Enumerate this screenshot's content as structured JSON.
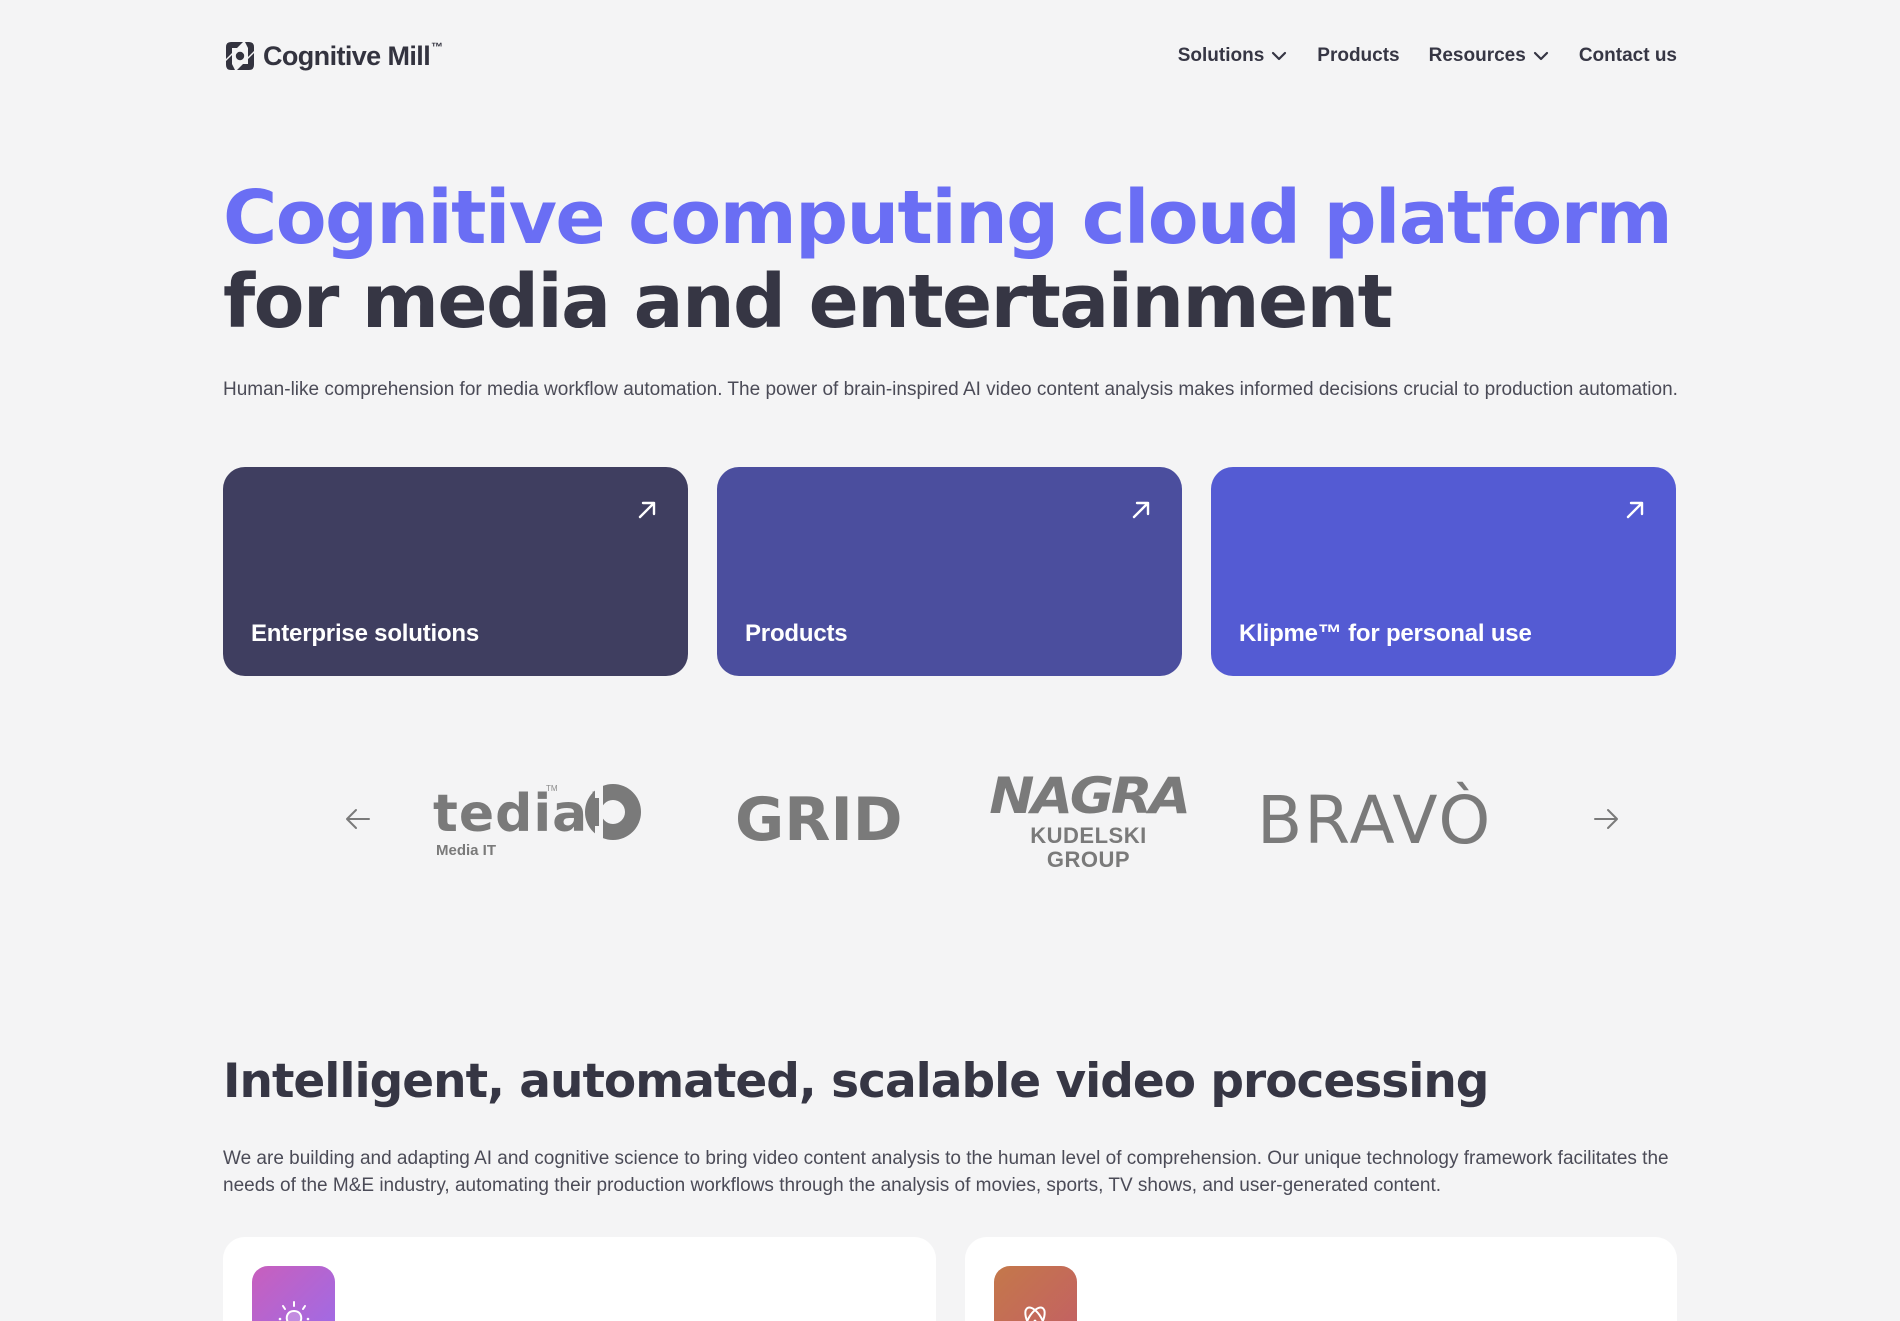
{
  "header": {
    "logo_text": "Cognitive Mill",
    "logo_tm": "™",
    "nav": [
      {
        "label": "Solutions",
        "has_dropdown": true
      },
      {
        "label": "Products",
        "has_dropdown": false
      },
      {
        "label": "Resources",
        "has_dropdown": true
      },
      {
        "label": "Contact us",
        "has_dropdown": false
      }
    ]
  },
  "hero": {
    "title_line1": "Cognitive computing cloud platform",
    "title_line2": "for media and entertainment",
    "subtitle": "Human-like comprehension for media workflow automation. The power of brain-inspired AI video content analysis makes informed decisions crucial to production automation.",
    "cards": [
      {
        "label": "Enterprise solutions",
        "icon": "arrow-up-right-icon",
        "color": "#3f3e60"
      },
      {
        "label": "Products",
        "icon": "arrow-up-right-icon",
        "color": "#4b4e9e"
      },
      {
        "label": "Klipme™ for personal use",
        "icon": "arrow-up-right-icon",
        "color": "#545bd3"
      }
    ]
  },
  "partners": {
    "prev_icon": "arrow-left-icon",
    "next_icon": "arrow-right-icon",
    "logos": [
      {
        "name": "tedial",
        "word": "tedial",
        "tm": "TM",
        "sub": "Media IT"
      },
      {
        "name": "grid",
        "word": "GRID"
      },
      {
        "name": "nagra",
        "word": "NAGRA",
        "sub": "KUDELSKI GROUP"
      },
      {
        "name": "bravo",
        "word": "BRAVÒ"
      }
    ]
  },
  "section": {
    "title": "Intelligent, automated, scalable video processing",
    "subtitle": "We are building and adapting AI and cognitive science to bring video content analysis to the human level of comprehension. Our unique technology framework facilitates the needs of the M&E industry, automating their production workflows through the analysis of movies, sports, TV shows, and user-generated content.",
    "features": [
      {
        "icon": "lightbulb-icon"
      },
      {
        "icon": "atom-icon"
      }
    ]
  },
  "colors": {
    "accent": "#6a6ef4",
    "text_dark": "#363644",
    "background": "#f4f4f5"
  }
}
